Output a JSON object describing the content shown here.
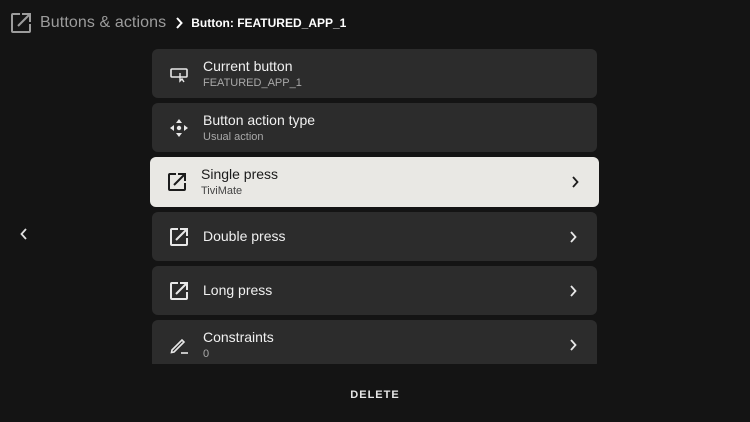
{
  "header": {
    "title": "Buttons & actions",
    "breadcrumb": "Button: FEATURED_APP_1",
    "icon": "open-external-icon"
  },
  "list": {
    "items": [
      {
        "title": "Current button",
        "subtitle": "FEATURED_APP_1",
        "icon": "remote-button-icon",
        "has_chevron": false,
        "focused": false
      },
      {
        "title": "Button action type",
        "subtitle": "Usual action",
        "icon": "dpad-arrows-icon",
        "has_chevron": false,
        "focused": false
      },
      {
        "title": "Single press",
        "subtitle": "TiviMate",
        "icon": "open-external-icon",
        "has_chevron": true,
        "focused": true
      },
      {
        "title": "Double press",
        "subtitle": "",
        "icon": "open-external-icon",
        "has_chevron": true,
        "focused": false
      },
      {
        "title": "Long press",
        "subtitle": "",
        "icon": "open-external-icon",
        "has_chevron": true,
        "focused": false
      },
      {
        "title": "Constraints",
        "subtitle": "0",
        "icon": "pencil-icon",
        "has_chevron": true,
        "focused": false
      }
    ]
  },
  "footer": {
    "delete_label": "DELETE"
  },
  "colors": {
    "background": "#141414",
    "row_background": "#2c2c2c",
    "focused_row_background": "#e9e8e4",
    "text_primary": "#f0f0f0",
    "text_secondary": "#a9a9a9"
  }
}
